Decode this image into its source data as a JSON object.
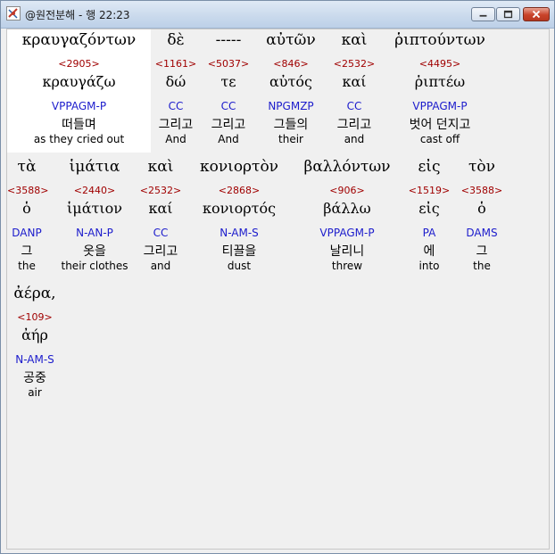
{
  "window": {
    "title": "@원전분해 - 행 22:23"
  },
  "words": [
    {
      "greek": "κραυγαζόντων",
      "strong": "<2905>",
      "lemma": "κραυγάζω",
      "parse": "VPPAGM-P",
      "korean": "떠들며",
      "english": "as they cried out",
      "selected": true
    },
    {
      "greek": "δὲ",
      "strong": "<1161>",
      "lemma": "δώ",
      "parse": "CC",
      "korean": "그리고",
      "english": "And"
    },
    {
      "greek": "-----",
      "strong": "<5037>",
      "lemma": "τε",
      "parse": "CC",
      "korean": "그리고",
      "english": "And"
    },
    {
      "greek": "αὐτῶν",
      "strong": "<846>",
      "lemma": "αὐτός",
      "parse": "NPGMZP",
      "korean": "그들의",
      "english": "their"
    },
    {
      "greek": "καὶ",
      "strong": "<2532>",
      "lemma": "καί",
      "parse": "CC",
      "korean": "그리고",
      "english": "and"
    },
    {
      "greek": "ῥιπτούντων",
      "strong": "<4495>",
      "lemma": "ῥιπτέω",
      "parse": "VPPAGM-P",
      "korean": "벗어 던지고",
      "english": "cast off"
    },
    {
      "greek": "τὰ",
      "strong": "<3588>",
      "lemma": "ὁ",
      "parse": "DANP",
      "korean": "그",
      "english": "the"
    },
    {
      "greek": "ἱμάτια",
      "strong": "<2440>",
      "lemma": "ἱμάτιον",
      "parse": "N-AN-P",
      "korean": "옷을",
      "english": "their clothes"
    },
    {
      "greek": "καὶ",
      "strong": "<2532>",
      "lemma": "καί",
      "parse": "CC",
      "korean": "그리고",
      "english": "and"
    },
    {
      "greek": "κονιορτὸν",
      "strong": "<2868>",
      "lemma": "κονιορτός",
      "parse": "N-AM-S",
      "korean": "티끌을",
      "english": "dust"
    },
    {
      "greek": "βαλλόντων",
      "strong": "<906>",
      "lemma": "βάλλω",
      "parse": "VPPAGM-P",
      "korean": "날리니",
      "english": "threw"
    },
    {
      "greek": "εἰς",
      "strong": "<1519>",
      "lemma": "εἰς",
      "parse": "PA",
      "korean": "에",
      "english": "into"
    },
    {
      "greek": "τὸν",
      "strong": "<3588>",
      "lemma": "ὁ",
      "parse": "DAMS",
      "korean": "그",
      "english": "the"
    },
    {
      "greek": "ἀέρα,",
      "strong": "<109>",
      "lemma": "ἀήρ",
      "parse": "N-AM-S",
      "korean": "공중",
      "english": "air"
    }
  ]
}
